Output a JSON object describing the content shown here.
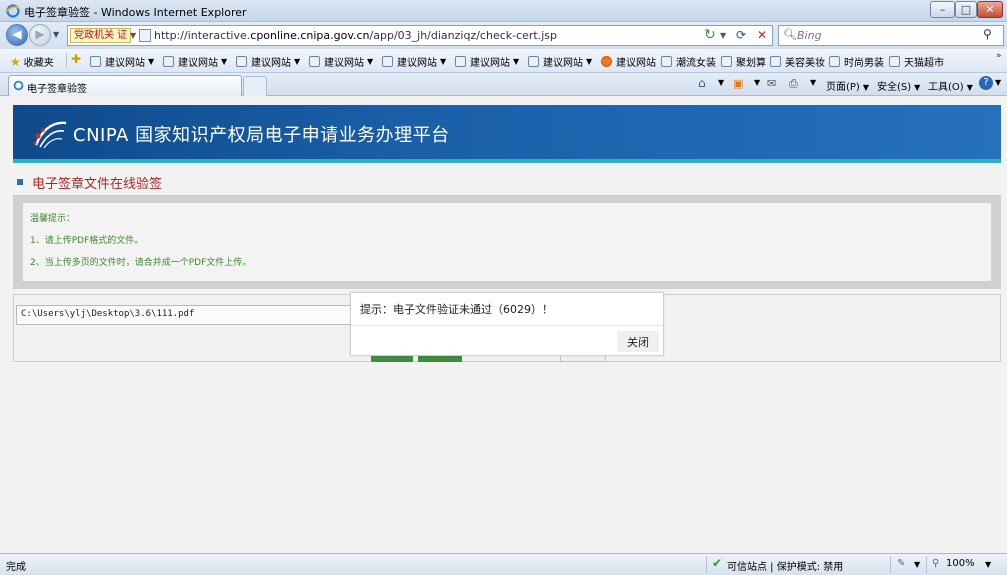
{
  "window": {
    "title": "电子签章验签 - Windows Internet Explorer"
  },
  "address": {
    "badge": "党政机关 证",
    "url_prefix": "http://interactive.",
    "url_domain": "cponline.cnipa.gov.cn",
    "url_path": "/app/03_jh/dianziqz/check-cert.jsp",
    "search_placeholder": "Bing"
  },
  "favorites": {
    "label": "收藏夹",
    "items": [
      "建议网站",
      "建议网站",
      "建议网站",
      "建议网站",
      "建议网站",
      "建议网站",
      "建议网站",
      "建议网站",
      "建议网站",
      "潮流女装",
      "聚划算",
      "美容美妆",
      "时尚男装",
      "天猫超市"
    ]
  },
  "tab": {
    "title": "电子签章验签"
  },
  "command_bar": {
    "page": "页面(P)",
    "safety": "安全(S)",
    "tools": "工具(O)"
  },
  "page": {
    "brand": "CNIPA 国家知识产权局电子申请业务办理平台",
    "heading": "电子签章文件在线验签",
    "tips": {
      "title": "温馨提示：",
      "line1": "1、请上传PDF格式的文件。",
      "line2": "2、当上传多页的文件时，请合并成一个PDF文件上传。"
    },
    "file_path": "C:\\Users\\ylj\\Desktop\\3.6\\111.pdf"
  },
  "dialog": {
    "message": "提示：电子文件验证未通过（6029）！",
    "close_label": "关闭"
  },
  "status": {
    "left": "完成",
    "trusted": "可信站点",
    "protected": "保护模式: 禁用",
    "zoom": "100%"
  },
  "colors": {
    "banner": "#1a5fa8",
    "banner_stripe": "#2ab0c8",
    "heading_text": "#b22222",
    "tip_text": "#3c8a2e",
    "green_button": "#3f8b3f"
  }
}
